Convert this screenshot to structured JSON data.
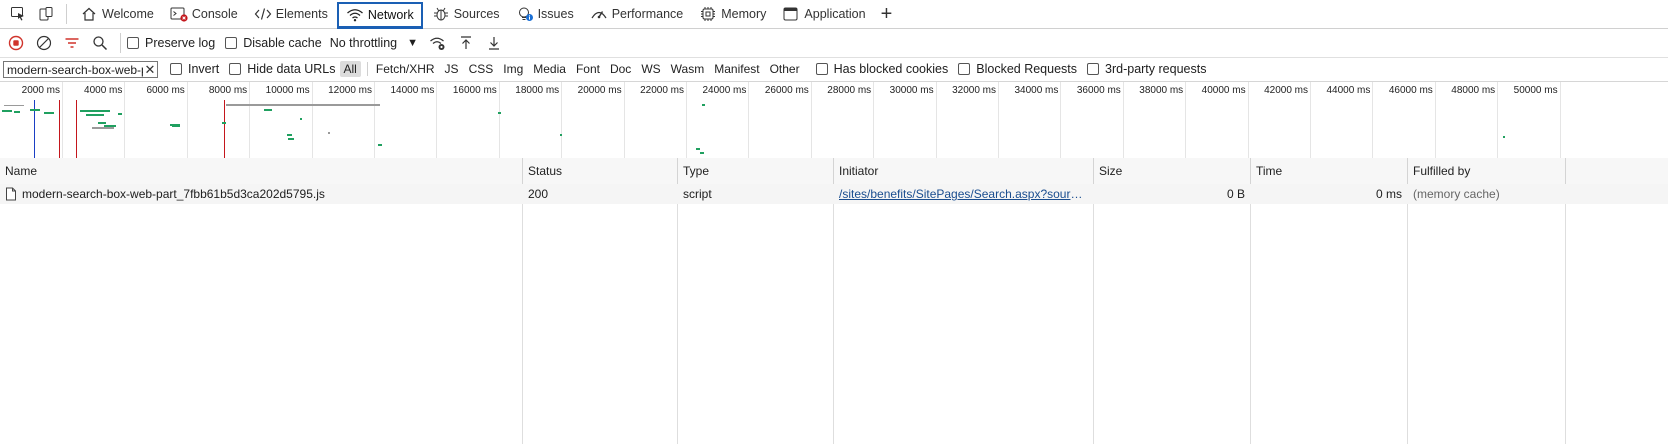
{
  "tabs": [
    {
      "label": "",
      "icon": "inspect-icon"
    },
    {
      "label": "",
      "icon": "device-emulation-icon"
    },
    {
      "label": "Welcome",
      "icon": "home-icon"
    },
    {
      "label": "Console",
      "icon": "console-icon"
    },
    {
      "label": "Elements",
      "icon": "code-icon"
    },
    {
      "label": "Network",
      "icon": "wifi-icon",
      "active": true
    },
    {
      "label": "Sources",
      "icon": "bug-icon"
    },
    {
      "label": "Issues",
      "icon": "bulb-icon"
    },
    {
      "label": "Performance",
      "icon": "performance-icon"
    },
    {
      "label": "Memory",
      "icon": "chip-icon"
    },
    {
      "label": "Application",
      "icon": "window-icon"
    },
    {
      "label": "+",
      "icon": "plus-icon"
    }
  ],
  "toolbar": {
    "preserve_log": "Preserve log",
    "disable_cache": "Disable cache",
    "throttling": "No throttling"
  },
  "filter": {
    "value": "modern-search-box-web-p",
    "invert": "Invert",
    "hide_data_urls": "Hide data URLs",
    "types": [
      "All",
      "Fetch/XHR",
      "JS",
      "CSS",
      "Img",
      "Media",
      "Font",
      "Doc",
      "WS",
      "Wasm",
      "Manifest",
      "Other"
    ],
    "active_type": "All",
    "has_blocked_cookies": "Has blocked cookies",
    "blocked_requests": "Blocked Requests",
    "third_party": "3rd-party requests"
  },
  "overview": {
    "ticks": [
      "2000 ms",
      "4000 ms",
      "6000 ms",
      "8000 ms",
      "10000 ms",
      "12000 ms",
      "14000 ms",
      "16000 ms",
      "18000 ms",
      "20000 ms",
      "22000 ms",
      "24000 ms",
      "26000 ms",
      "28000 ms",
      "30000 ms",
      "32000 ms",
      "34000 ms",
      "36000 ms",
      "38000 ms",
      "40000 ms",
      "42000 ms",
      "44000 ms",
      "46000 ms",
      "48000 ms",
      "50000 ms"
    ],
    "colors": {
      "dom_content_loaded": "#1a3fc4",
      "load": "#c4161c",
      "request": "#20a060",
      "queue": "#9a9a9a"
    }
  },
  "table": {
    "columns": [
      "Name",
      "Status",
      "Type",
      "Initiator",
      "Size",
      "Time",
      "Fulfilled by"
    ],
    "rows": [
      {
        "name": "modern-search-box-web-part_7fbb61b5d3ca202d5795.js",
        "status": "200",
        "type": "script",
        "initiator": "/sites/benefits/SitePages/Search.aspx?source=ht...",
        "size": "0 B",
        "time": "0 ms",
        "fulfilled_by": "(memory cache)"
      }
    ]
  }
}
